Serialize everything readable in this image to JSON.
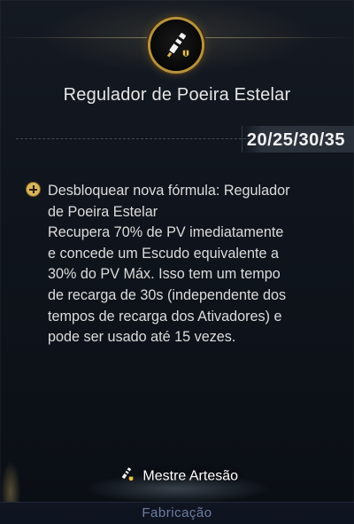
{
  "header": {
    "emblem_icon": "prism-syringe-icon",
    "title": "Regulador de Poeira Estelar",
    "tiers": "20/25/30/35"
  },
  "description": {
    "bullet_icon": "plus-circle-icon",
    "lines": [
      "Desbloquear nova fórmula: Regulador",
      "de Poeira Estelar",
      "Recupera 70% de PV imediatamente",
      "e concede um Escudo equivalente a",
      "30% do PV Máx. Isso tem um tempo",
      "de recarga de 30s (independente dos",
      "tempos de recarga dos Ativadores) e",
      "pode ser usado até 15 vezes."
    ]
  },
  "footer": {
    "role_icon": "prism-syringe-icon",
    "role_label": "Mestre Artesão",
    "category": "Fabricação"
  },
  "colors": {
    "accent_gold": "#d8b55a",
    "text": "#dcdcdc",
    "category_text": "#6d7ea0"
  }
}
